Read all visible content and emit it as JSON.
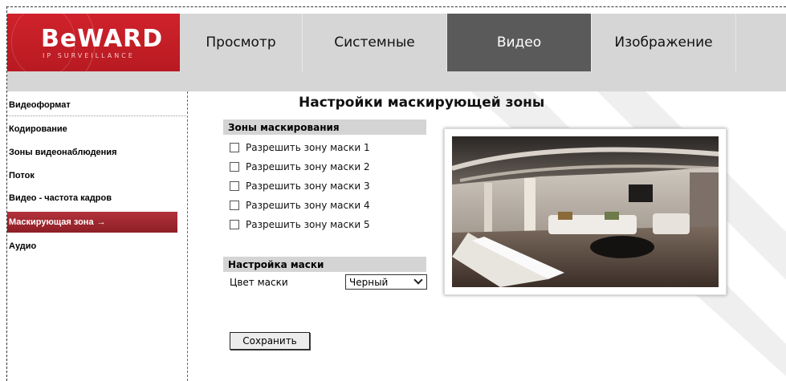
{
  "header": {
    "brand": "BeWARD",
    "brand_sub": "IP SURVEILLANCE",
    "tabs": [
      {
        "label": "Просмотр",
        "active": false
      },
      {
        "label": "Системные",
        "active": false
      },
      {
        "label": "Видео",
        "active": true
      },
      {
        "label": "Изображение",
        "active": false
      }
    ]
  },
  "sidebar": {
    "items": [
      {
        "label": "Видеоформат",
        "active": false
      },
      {
        "label": "Кодирование",
        "active": false
      },
      {
        "label": "Зоны видеонаблюдения",
        "active": false
      },
      {
        "label": "Поток",
        "active": false
      },
      {
        "label": "Видео - частота кадров",
        "active": false
      },
      {
        "label": "Маскирующая зона",
        "active": true,
        "arrow": "→"
      },
      {
        "label": "Аудио",
        "active": false
      }
    ]
  },
  "main": {
    "title": "Настройки маскирующей зоны",
    "zones_section": "Зоны маскирования",
    "zones": [
      {
        "label": "Разрешить зону маски 1",
        "checked": false
      },
      {
        "label": "Разрешить зону маски 2",
        "checked": false
      },
      {
        "label": "Разрешить зону маски 3",
        "checked": false
      },
      {
        "label": "Разрешить зону маски 4",
        "checked": false
      },
      {
        "label": "Разрешить зону маски 5",
        "checked": false
      }
    ],
    "mask_section": "Настройка маски",
    "mask_color_label": "Цвет маски",
    "mask_color_value": "Черный",
    "save_label": "Сохранить"
  },
  "colors": {
    "brand_red": "#c81f28",
    "active_tab": "#5a5a5a",
    "header_gray": "#d6d6d6",
    "section_gray": "#d4d4d4"
  }
}
